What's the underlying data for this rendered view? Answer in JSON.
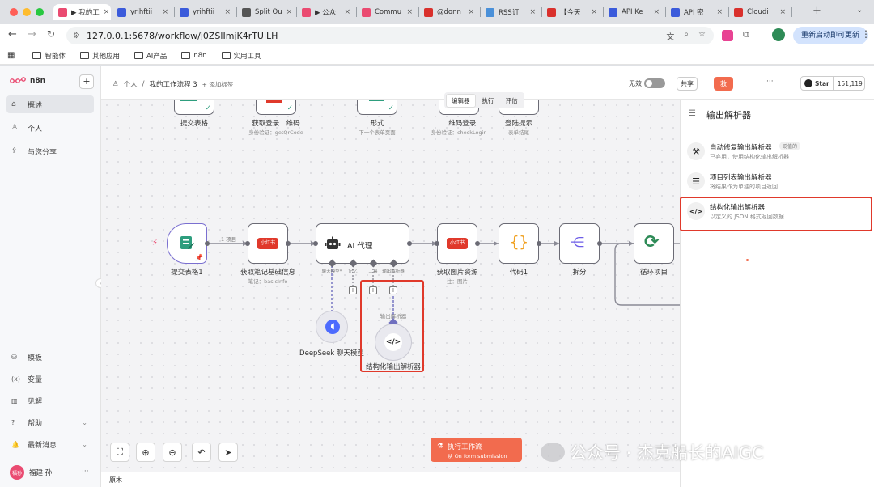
{
  "browser": {
    "tabs": [
      {
        "label": "▶ 我的工",
        "color": "#ea4b71",
        "active": true
      },
      {
        "label": "yrihftii",
        "color": "#3b5bdb"
      },
      {
        "label": "yrihftii",
        "color": "#3b5bdb"
      },
      {
        "label": "Split Ou",
        "color": "#555"
      },
      {
        "label": "▶ 公众",
        "color": "#ea4b71"
      },
      {
        "label": "Commu",
        "color": "#ea4b71"
      },
      {
        "label": "@donn",
        "color": "#d9302c"
      },
      {
        "label": "RSS订",
        "color": "#4a90d9"
      },
      {
        "label": "【今天",
        "color": "#d9302c"
      },
      {
        "label": "API Ke",
        "color": "#3b5bdb"
      },
      {
        "label": "API 密",
        "color": "#3b5bdb"
      },
      {
        "label": "Cloudi",
        "color": "#d9302c"
      }
    ],
    "new_tab": "+",
    "url": "127.0.0.1:5678/workflow/j0ZSlImjK4rTUlLH",
    "update_button": "重新启动即可更新",
    "bookmarks": [
      "智能体",
      "其他应用",
      "AI产品",
      "n8n",
      "实用工具"
    ]
  },
  "sidebar": {
    "brand": "n8n",
    "add": "+",
    "items": [
      {
        "label": "概述",
        "icon": "home-icon"
      },
      {
        "label": "个人",
        "icon": "user-icon"
      },
      {
        "label": "与您分享",
        "icon": "share-icon"
      }
    ],
    "bottom_items": [
      {
        "label": "模板",
        "icon": "templates-icon"
      },
      {
        "label": "变量",
        "icon": "variables-icon"
      },
      {
        "label": "见解",
        "icon": "insights-icon"
      },
      {
        "label": "帮助",
        "icon": "help-icon"
      },
      {
        "label": "最新消息",
        "icon": "bell-icon"
      }
    ],
    "user_name": "福建 孙",
    "user_initials": "福孙",
    "more": "···"
  },
  "header": {
    "breadcrumb_owner": "个人",
    "breadcrumb_sep": "/",
    "workflow_name": "我的工作流程 3",
    "add_tag": "+ 添加标签",
    "inactive_label": "无效",
    "share": "共享",
    "save": "救",
    "more": "···",
    "github_star": "Star",
    "github_count": "151,119"
  },
  "mode_tabs": [
    "编辑器",
    "执行",
    "评估"
  ],
  "top_nodes": [
    {
      "label": "提交表格",
      "sub": ""
    },
    {
      "label": "获取登录二维码",
      "sub": "身份验证：getQrCode"
    },
    {
      "label": "形式",
      "sub": "下一个表单页面"
    },
    {
      "label": "二维码登录",
      "sub": "身份验证：checkLogin"
    },
    {
      "label": "登陆提示",
      "sub": "表单结尾"
    }
  ],
  "nodes": {
    "form": {
      "label": "提交表格1"
    },
    "edge_label": "1 项目",
    "xhs1": {
      "label": "获取笔记基础信息",
      "sub": "笔记：basicInfo",
      "badge": "小红书"
    },
    "agent": {
      "label": "AI 代理"
    },
    "agent_ports": [
      "聊天模型*",
      "记忆",
      "工具",
      "输出解析器"
    ],
    "xhs2": {
      "label": "获取图片资源",
      "sub": "注：图片",
      "badge": "小红书"
    },
    "code": {
      "label": "代码1"
    },
    "split": {
      "label": "拆分"
    },
    "loop": {
      "label": "循环项目"
    },
    "deepseek": {
      "label": "DeepSeek 聊天模型"
    },
    "parser_port": "输出解析器",
    "parser": {
      "label": "结构化输出解析器"
    }
  },
  "canvas_footer": "原木",
  "execute": {
    "title": "执行工作流",
    "sub": "从 On form submission"
  },
  "watermark": "公众号 · 杰克船长的AIGC",
  "panel": {
    "title": "输出解析器",
    "items": [
      {
        "title": "自动修复输出解析器",
        "badge": "贬值的",
        "desc": "已弃用，使用结构化输出解析器",
        "icon": "tools-icon"
      },
      {
        "title": "项目列表输出解析器",
        "badge": "",
        "desc": "将结果作为单独的项目返回",
        "icon": "list-icon"
      },
      {
        "title": "结构化输出解析器",
        "badge": "",
        "desc": "以定义的 JSON 格式返回数据",
        "icon": "code-icon"
      }
    ]
  },
  "colors": {
    "accent": "#ea4b71",
    "highlight": "#e0392b",
    "xhs": "#e0392b",
    "code": "#f0a020",
    "split": "#6c5ce7",
    "loop": "#2e8b57"
  }
}
